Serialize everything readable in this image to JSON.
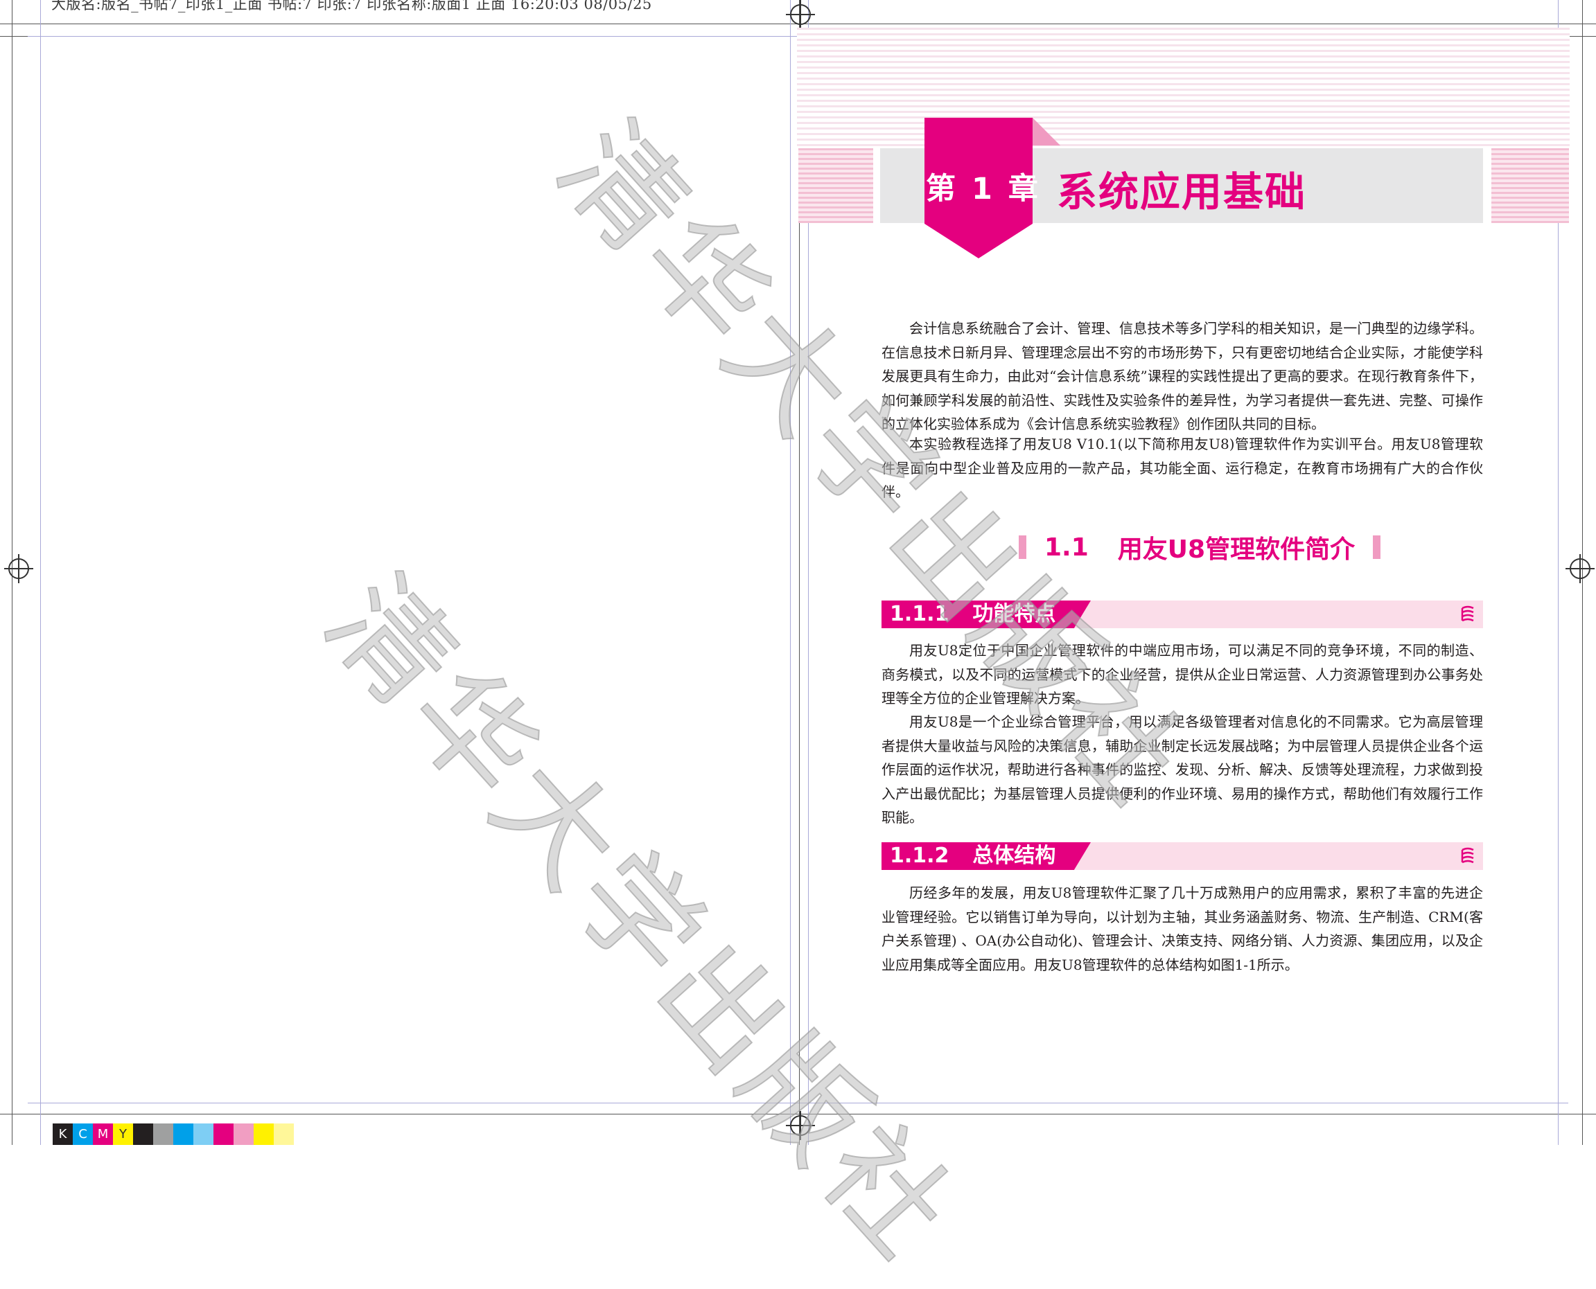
{
  "slug": "大版名:版名_书帖7_印张1_正面 书帖:7 印张:7 印张名称:版面1 正面 16:20:03 08/05/25",
  "watermark": {
    "text1": "清华大学出版社",
    "text2": "清华大学出版社"
  },
  "chapter": {
    "number": "第 1 章",
    "title": "系统应用基础"
  },
  "intro_paragraphs": [
    "会计信息系统融合了会计、管理、信息技术等多门学科的相关知识，是一门典型的边缘学科。在信息技术日新月异、管理理念层出不穷的市场形势下，只有更密切地结合企业实际，才能使学科发展更具有生命力，由此对“会计信息系统”课程的实践性提出了更高的要求。在现行教育条件下，如何兼顾学科发展的前沿性、实践性及实验条件的差异性，为学习者提供一套先进、完整、可操作的立体化实验体系成为《会计信息系统实验教程》创作团队共同的目标。",
    "本实验教程选择了用友U8 V10.1(以下简称用友U8)管理软件作为实训平台。用友U8管理软件是面向中型企业普及应用的一款产品，其功能全面、运行稳定，在教育市场拥有广大的合作伙伴。"
  ],
  "section": {
    "number": "1.1",
    "title": "用友U8管理软件简介"
  },
  "subsections": [
    {
      "number": "1.1.1",
      "title": "功能特点",
      "paragraphs": [
        "用友U8定位于中国企业管理软件的中端应用市场，可以满足不同的竞争环境，不同的制造、商务模式，以及不同的运营模式下的企业经营，提供从企业日常运营、人力资源管理到办公事务处理等全方位的企业管理解决方案。",
        "用友U8是一个企业综合管理平台，用以满足各级管理者对信息化的不同需求。它为高层管理者提供大量收益与风险的决策信息，辅助企业制定长远发展战略；为中层管理人员提供企业各个运作层面的运作状况，帮助进行各种事件的监控、发现、分析、解决、反馈等处理流程，力求做到投入产出最优配比；为基层管理人员提供便利的作业环境、易用的操作方式，帮助他们有效履行工作职能。"
      ]
    },
    {
      "number": "1.1.2",
      "title": "总体结构",
      "paragraphs": [
        "历经多年的发展，用友U8管理软件汇聚了几十万成熟用户的应用需求，累积了丰富的先进企业管理经验。它以销售订单为导向，以计划为主轴，其业务涵盖财务、物流、生产制造、CRM(客户关系管理) 、OA(办公自动化)、管理会计、决策支持、网络分销、人力资源、集团应用，以及企业应用集成等全面应用。用友U8管理软件的总体结构如图1-1所示。"
      ]
    }
  ],
  "subsection_icon": "book-stack-icon",
  "color_bar": {
    "labels": [
      "K",
      "C",
      "M",
      "Y"
    ],
    "colors": [
      "#231f20",
      "#00a0e9",
      "#e4007f",
      "#fff100",
      "#231f20",
      "#9fa0a0",
      "#00a0e9",
      "#7ecef4",
      "#e4007f",
      "#f19ec2",
      "#fff100",
      "#fff799"
    ]
  },
  "colors": {
    "accent": "#e4007f",
    "accent_light": "#fbdde9",
    "gray_bar": "#e6e6e7"
  }
}
